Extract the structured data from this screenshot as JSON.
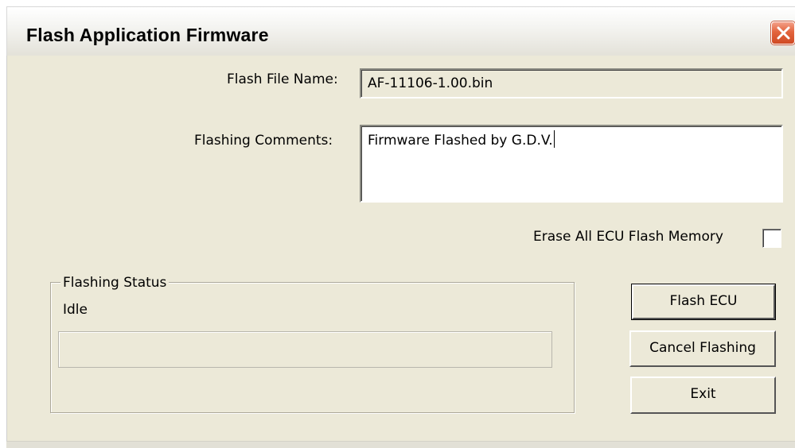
{
  "window": {
    "title": "Flash Application Firmware",
    "close_icon": "close-x-icon",
    "accent_close": "#d9542d"
  },
  "form": {
    "flash_file_label": "Flash File Name:",
    "flash_file_value": "AF-11106-1.00.bin",
    "comments_label": "Flashing Comments:",
    "comments_value": "Firmware Flashed by G.D.V.",
    "erase_label": "Erase All ECU Flash Memory",
    "erase_checked": false
  },
  "status": {
    "group_title": "Flashing Status",
    "text": "Idle",
    "progress": 0
  },
  "buttons": {
    "flash": "Flash ECU",
    "cancel": "Cancel Flashing",
    "exit": "Exit"
  }
}
